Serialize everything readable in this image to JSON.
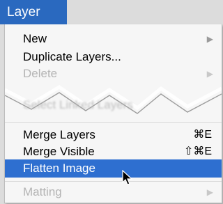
{
  "menubar": {
    "title": "Layer"
  },
  "menu": {
    "new_label": "New",
    "duplicate_label": "Duplicate Layers...",
    "delete_label": "Delete",
    "select_linked_label": "Select Linked Layers",
    "merge_layers_label": "Merge Layers",
    "merge_layers_shortcut": "⌘E",
    "merge_visible_label": "Merge Visible",
    "merge_visible_shortcut": "⇧⌘E",
    "flatten_label": "Flatten Image",
    "matting_label": "Matting"
  },
  "colors": {
    "highlight": "#2e6fd0",
    "menubar_title_bg": "#2a69bf"
  }
}
